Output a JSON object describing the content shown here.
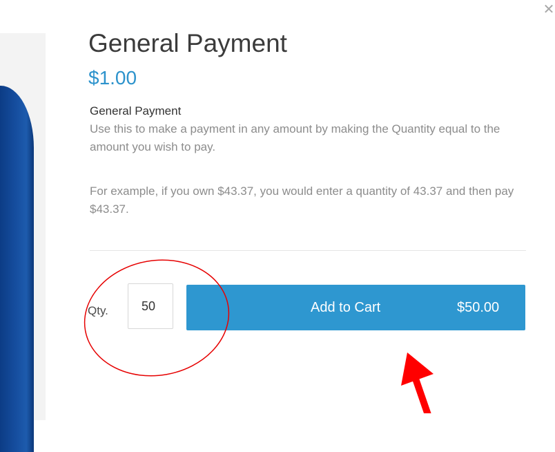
{
  "modal": {
    "title": "General Payment",
    "price": "$1.00",
    "close_icon": "close-icon"
  },
  "description": {
    "title": "General Payment",
    "paragraphs": [
      "Use this to make a payment in any amount by making the Quantity equal to the amount you wish to pay.",
      "For example, if you own $43.37, you would enter a quantity of 43.37 and then pay $43.37."
    ]
  },
  "quantity": {
    "label": "Qty.",
    "value": "50"
  },
  "cart": {
    "button_label": "Add to Cart",
    "total": "$50.00"
  },
  "colors": {
    "accent": "#2e97d0",
    "price": "#2d93cc",
    "annotation": "#e60000"
  }
}
